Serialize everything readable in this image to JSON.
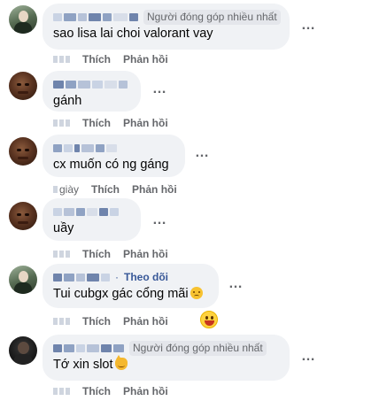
{
  "comments": [
    {
      "badge": "Người đóng góp nhiều nhất",
      "text": "sao lisa lai choi valorant vay",
      "actions": {
        "like": "Thích",
        "reply": "Phản hồi"
      }
    },
    {
      "text": "gánh",
      "actions": {
        "like": "Thích",
        "reply": "Phản hồi"
      }
    },
    {
      "text": "cx muốn có ng gáng",
      "actions": {
        "time_suffix": "giày",
        "like": "Thích",
        "reply": "Phản hồi"
      }
    },
    {
      "text": "uầy",
      "actions": {
        "like": "Thích",
        "reply": "Phản hồi"
      }
    },
    {
      "follow_separator": "·",
      "follow": "Theo dõi",
      "text": "Tui cubgx gác cổng mãi",
      "text_emoji": "sweat-smile-emoji",
      "reaction_emoji": "laughing-emoji",
      "actions": {
        "like": "Thích",
        "reply": "Phản hồi"
      }
    },
    {
      "badge": "Người đóng góp nhiều nhất",
      "text": "Tớ xin slot",
      "text_emoji": "cat-emoji",
      "actions": {
        "like": "Thích",
        "reply": "Phản hồi"
      }
    }
  ],
  "more_icon": "…",
  "colors": {
    "bubble": "#f0f2f5",
    "secondary_text": "#65676b",
    "link": "#385898",
    "badge_bg": "#e4e6eb"
  }
}
